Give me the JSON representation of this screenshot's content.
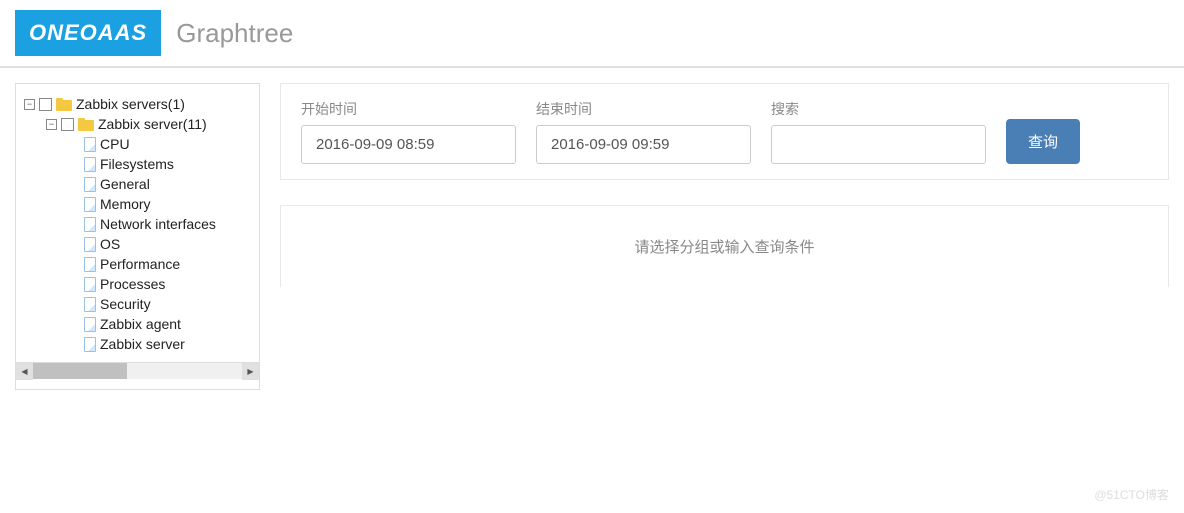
{
  "header": {
    "logo_text": "ONEOAAS",
    "page_title": "Graphtree"
  },
  "tree": {
    "root": {
      "label": "Zabbix servers(1)",
      "expanded": true,
      "children": [
        {
          "label": "Zabbix server(11)",
          "expanded": true,
          "items": [
            "CPU",
            "Filesystems",
            "General",
            "Memory",
            "Network interfaces",
            "OS",
            "Performance",
            "Processes",
            "Security",
            "Zabbix agent",
            "Zabbix server"
          ]
        }
      ]
    }
  },
  "filter": {
    "start_label": "开始时间",
    "start_value": "2016-09-09 08:59",
    "end_label": "结束时间",
    "end_value": "2016-09-09 09:59",
    "search_label": "搜索",
    "search_value": "",
    "query_button": "查询"
  },
  "result": {
    "placeholder": "请选择分组或输入查询条件"
  },
  "watermark": "@51CTO博客"
}
